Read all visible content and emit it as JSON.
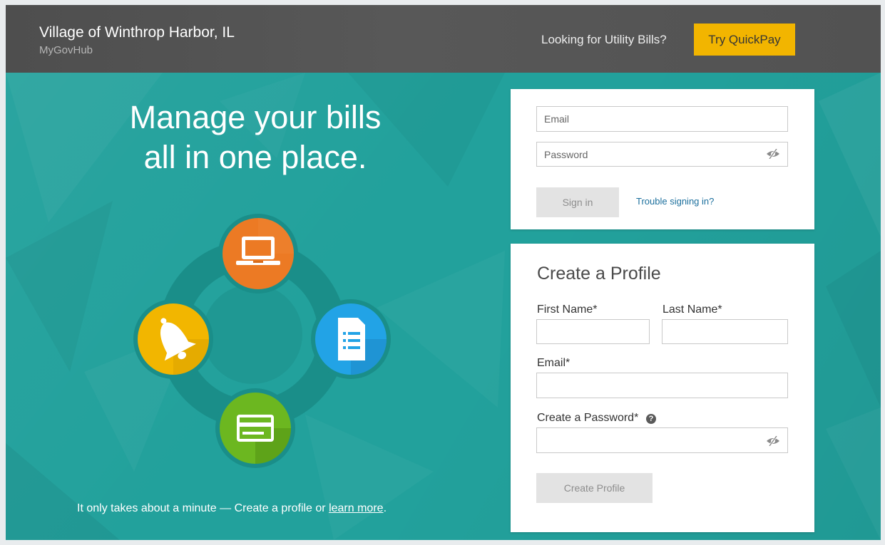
{
  "header": {
    "title": "Village of Winthrop Harbor, IL",
    "subtitle": "MyGovHub",
    "utility_question": "Looking for Utility Bills?",
    "quickpay_label": "Try QuickPay"
  },
  "hero": {
    "headline_line1": "Manage your bills",
    "headline_line2": "all in one place.",
    "tagline_prefix": "It only takes about a minute — Create a profile or ",
    "tagline_link": "learn more",
    "tagline_suffix": "."
  },
  "signin": {
    "email_placeholder": "Email",
    "password_placeholder": "Password",
    "signin_label": "Sign in",
    "trouble_label": "Trouble signing in?"
  },
  "profile": {
    "title": "Create a Profile",
    "first_name_label": "First Name*",
    "last_name_label": "Last Name*",
    "email_label": "Email*",
    "password_label": "Create a Password*",
    "help_glyph": "?",
    "submit_label": "Create Profile"
  },
  "colors": {
    "teal": "#22a19c",
    "header": "#555555",
    "quickpay": "#f2b500",
    "laptop_circle": "#ec7a24",
    "bell_circle": "#f2b600",
    "document_circle": "#22a3e6",
    "card_circle": "#6cb720",
    "link": "#1b6f9d"
  },
  "icons": [
    "laptop-icon",
    "bell-icon",
    "document-icon",
    "credit-card-icon",
    "eye-slash-icon",
    "question-circle-icon"
  ]
}
